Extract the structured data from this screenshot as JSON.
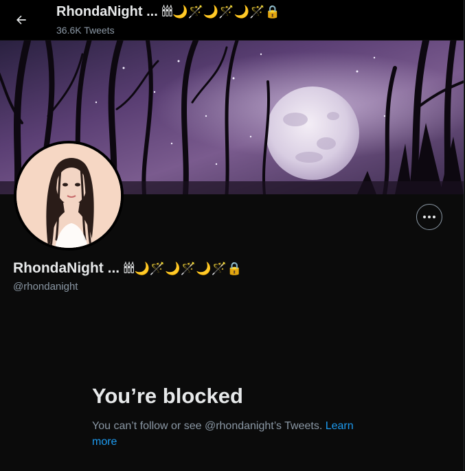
{
  "header": {
    "back_icon": "arrow-left-icon",
    "title": "RhondaNight ...",
    "title_emojis": "🕯🕯🕯🌙🪄🌙🪄🌙🪄🔒",
    "tweet_count": "36.6K Tweets"
  },
  "banner": {
    "description_icon": "moonlit-forest-banner"
  },
  "profile": {
    "avatar_icon": "avatar-illustration",
    "more_icon": "more-horizontal-icon",
    "name": "RhondaNight ...",
    "name_emojis": "🕯🕯🕯🌙🪄🌙🪄🌙🪄🔒",
    "handle": "@rhondanight"
  },
  "blocked": {
    "title": "You’re blocked",
    "message": "You can’t follow or see @rhondanight’s Tweets.",
    "link_label": "Learn more"
  },
  "colors": {
    "background": "#0b0b0b",
    "text_primary": "#e7e9ea",
    "text_secondary": "#8b98a5",
    "link": "#1d9bf0"
  }
}
